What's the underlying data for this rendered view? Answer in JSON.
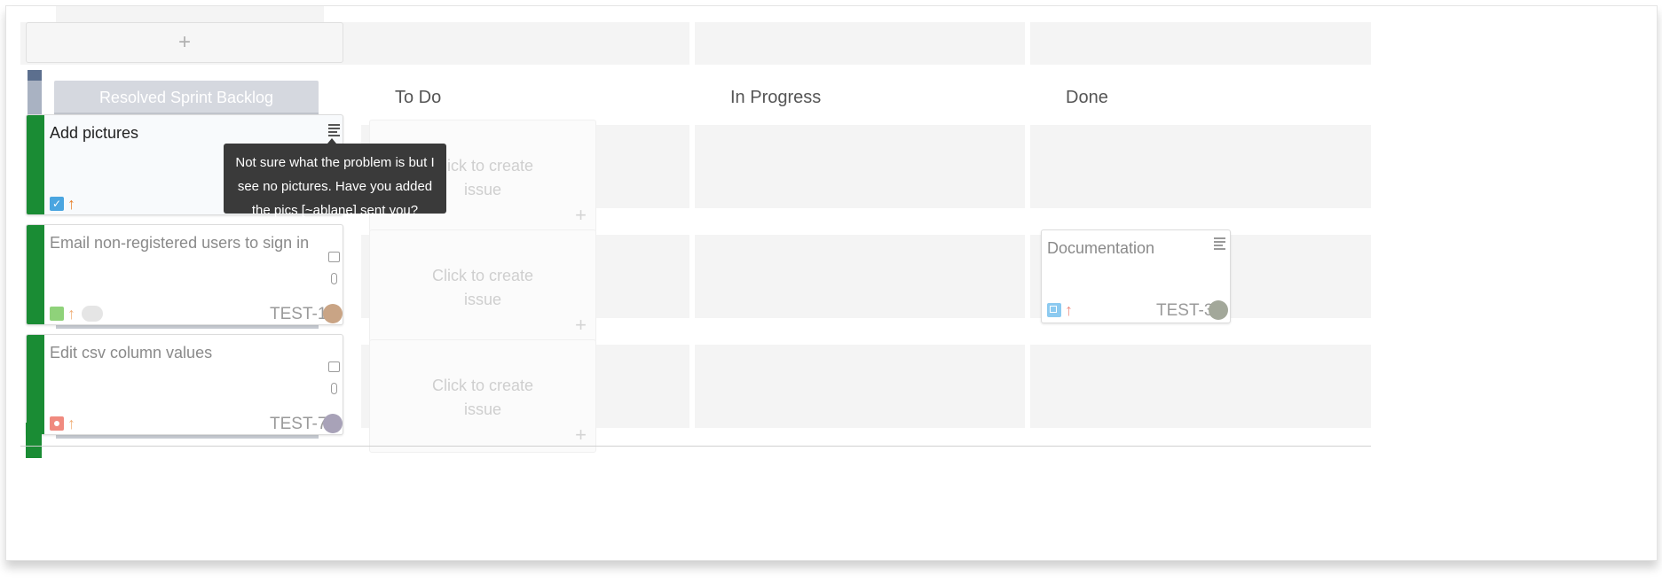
{
  "top_add": {
    "label": "+"
  },
  "backlog": {
    "title": "Resolved Sprint Backlog"
  },
  "columns": [
    {
      "title": "To Do"
    },
    {
      "title": "In Progress"
    },
    {
      "title": "Done"
    }
  ],
  "cards": [
    {
      "title": "Add pictures",
      "key": "",
      "type": "task",
      "priority": "high"
    },
    {
      "title": "Email non-registered users to sign in",
      "key": "TEST-1",
      "type": "story",
      "priority": "high"
    },
    {
      "title": "Edit csv column values",
      "key": "TEST-7",
      "type": "bug",
      "priority": "high"
    }
  ],
  "placeholders": [
    {
      "text": "Click to create issue",
      "plus": "+"
    },
    {
      "text": "Click to create issue",
      "plus": "+"
    },
    {
      "text": "Click to create issue",
      "plus": "+"
    }
  ],
  "done_card": {
    "title": "Documentation",
    "key": "TEST-3",
    "type": "subtask",
    "priority": "high"
  },
  "tooltip": {
    "text": "Not sure what the problem is but I see no pictures. Have you added the pics [~ablane] sent you?"
  },
  "colors": {
    "accent_green": "#1a8c34",
    "priority_orange": "#e8822f",
    "priority_red": "#e5553e",
    "task_blue": "#4aa5e0",
    "story_green": "#63ba3c",
    "bug_red": "#e5493a",
    "subtask_blue": "#4bade8",
    "backlog_header": "#d5d8df"
  },
  "icons": {
    "description": "description-lines-icon",
    "comment": "comment-icon",
    "attachment": "paperclip-icon"
  }
}
